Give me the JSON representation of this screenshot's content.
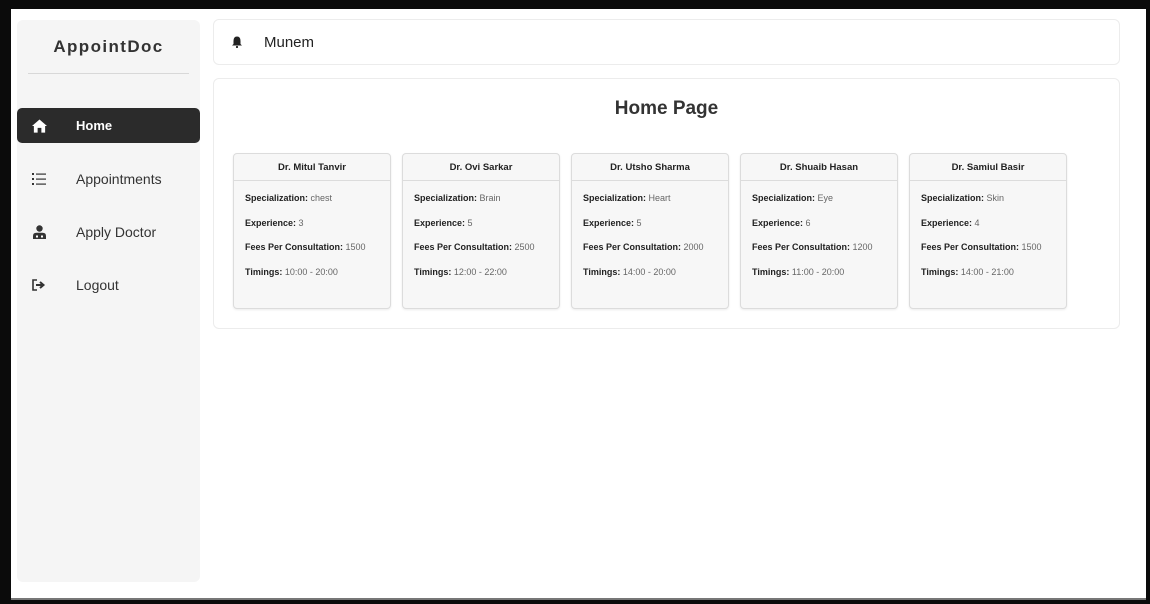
{
  "brand": "AppointDoc",
  "menu": [
    {
      "label": "Home",
      "icon": "home-icon",
      "active": true
    },
    {
      "label": "Appointments",
      "icon": "list-icon",
      "active": false
    },
    {
      "label": "Apply Doctor",
      "icon": "user-doctor-icon",
      "active": false
    },
    {
      "label": "Logout",
      "icon": "logout-icon",
      "active": false
    }
  ],
  "header": {
    "user": "Munem",
    "icon": "bell-icon"
  },
  "page_title": "Home Page",
  "field_labels": {
    "specialization": "Specialization:",
    "experience": "Experience:",
    "fees": "Fees Per Consultation:",
    "timings": "Timings:"
  },
  "doctors": [
    {
      "name": "Dr. Mitul Tanvir",
      "specialization": "chest",
      "experience": "3",
      "fees": "1500",
      "timings": "10:00 - 20:00"
    },
    {
      "name": "Dr. Ovi Sarkar",
      "specialization": "Brain",
      "experience": "5",
      "fees": "2500",
      "timings": "12:00 - 22:00"
    },
    {
      "name": "Dr. Utsho Sharma",
      "specialization": "Heart",
      "experience": "5",
      "fees": "2000",
      "timings": "14:00 - 20:00"
    },
    {
      "name": "Dr. Shuaib Hasan",
      "specialization": "Eye",
      "experience": "6",
      "fees": "1200",
      "timings": "11:00 - 20:00"
    },
    {
      "name": "Dr. Samiul Basir",
      "specialization": "Skin",
      "experience": "4",
      "fees": "1500",
      "timings": "14:00 - 21:00"
    }
  ],
  "colors": {
    "active_menu_bg": "#2b2b2b",
    "sidebar_bg": "#f5f5f5",
    "card_bg": "#f7f7f7"
  }
}
